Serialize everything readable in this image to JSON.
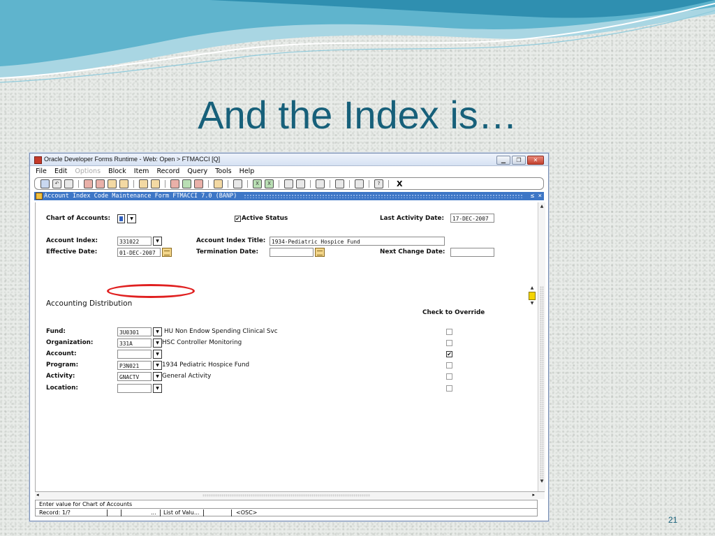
{
  "slide": {
    "title": "And the Index is…",
    "number": "21"
  },
  "window": {
    "title": "Oracle Developer Forms Runtime - Web:  Open > FTMACCI [Q]"
  },
  "menu": [
    "File",
    "Edit",
    "Options",
    "Block",
    "Item",
    "Record",
    "Query",
    "Tools",
    "Help"
  ],
  "toolbar": {
    "close_label": "X"
  },
  "form": {
    "title": "Account Index Code Maintenance Form  FTMACCI  7.0  (BANP)",
    "header_right": "≤ ×",
    "chart_label": "Chart of Accounts:",
    "chart_value": "",
    "active_status_label": "Active Status",
    "active_status_checked": true,
    "last_activity_label": "Last Activity Date:",
    "last_activity_value": "17-DEC-2007",
    "account_index_label": "Account Index:",
    "account_index_value": "331022",
    "account_index_title_label": "Account Index Title:",
    "account_index_title_value": "1934-Pediatric Hospice Fund",
    "effective_date_label": "Effective Date:",
    "effective_date_value": "01-DEC-2007",
    "termination_date_label": "Termination Date:",
    "termination_date_value": "",
    "next_change_label": "Next Change Date:",
    "next_change_value": "",
    "distribution_title": "Accounting Distribution",
    "override_header": "Check to Override",
    "rows": [
      {
        "label": "Fund:",
        "code": "3U0301",
        "desc": "HU Non Endow Spending Clinical Svc",
        "override": false
      },
      {
        "label": "Organization:",
        "code": "331A",
        "desc": "HSC Controller Monitoring",
        "override": false
      },
      {
        "label": "Account:",
        "code": "",
        "desc": "",
        "override": true
      },
      {
        "label": "Program:",
        "code": "P3N021",
        "desc": "1934 Pediatric Hospice Fund",
        "override": false
      },
      {
        "label": "Activity:",
        "code": "GNACTV",
        "desc": "General Activity",
        "override": false
      },
      {
        "label": "Location:",
        "code": "",
        "desc": "",
        "override": false
      }
    ]
  },
  "status": {
    "hint": "Enter value for Chart of Accounts",
    "record": "Record: 1/?",
    "dots": "...",
    "lov": "List of Valu...",
    "osc": "<OSC>"
  }
}
